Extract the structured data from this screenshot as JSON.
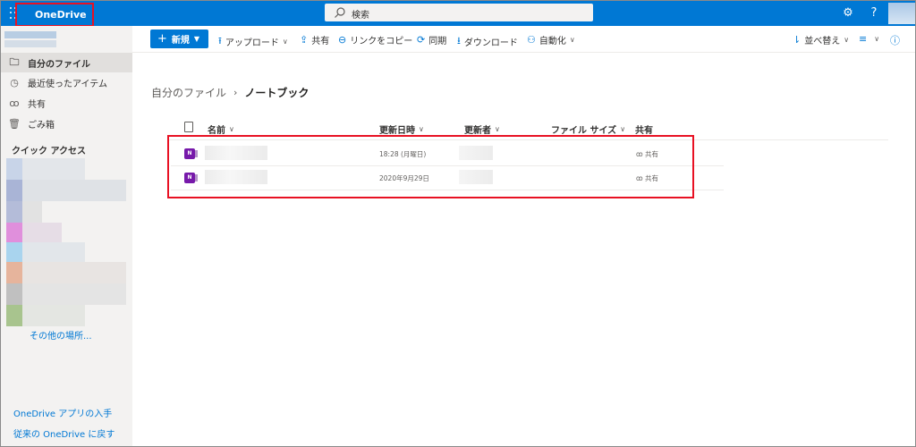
{
  "topbar": {
    "brand": "OneDrive",
    "search_placeholder": "検索",
    "help": "?"
  },
  "sidebar": {
    "items": [
      {
        "label": "自分のファイル",
        "icon": "folder-icon",
        "active": true
      },
      {
        "label": "最近使ったアイテム",
        "icon": "recent-icon",
        "active": false
      },
      {
        "label": "共有",
        "icon": "shared-icon",
        "active": false
      },
      {
        "label": "ごみ箱",
        "icon": "recycle-bin-icon",
        "active": false
      }
    ],
    "quick_access_title": "クイック アクセス",
    "more_places": "その他の場所...",
    "get_apps": "OneDrive アプリの入手",
    "return_classic": "従来の OneDrive に戻す"
  },
  "commandbar": {
    "new": "新規",
    "upload": "アップロード",
    "share": "共有",
    "copy_link": "リンクをコピー",
    "sync": "同期",
    "download": "ダウンロード",
    "automate": "自動化",
    "sort": "並べ替え"
  },
  "breadcrumb": {
    "root": "自分のファイル",
    "current": "ノートブック"
  },
  "list": {
    "columns": {
      "name": "名前",
      "modified": "更新日時",
      "modified_by": "更新者",
      "file_size": "ファイル サイズ",
      "sharing": "共有"
    },
    "rows": [
      {
        "modified": "18:28 (月曜日)",
        "sharing": "共有"
      },
      {
        "modified": "2020年9月29日",
        "sharing": "共有"
      }
    ]
  },
  "colors": {
    "accent": "#0078d4",
    "highlight_box": "#e81123",
    "onenote": "#7719aa"
  }
}
